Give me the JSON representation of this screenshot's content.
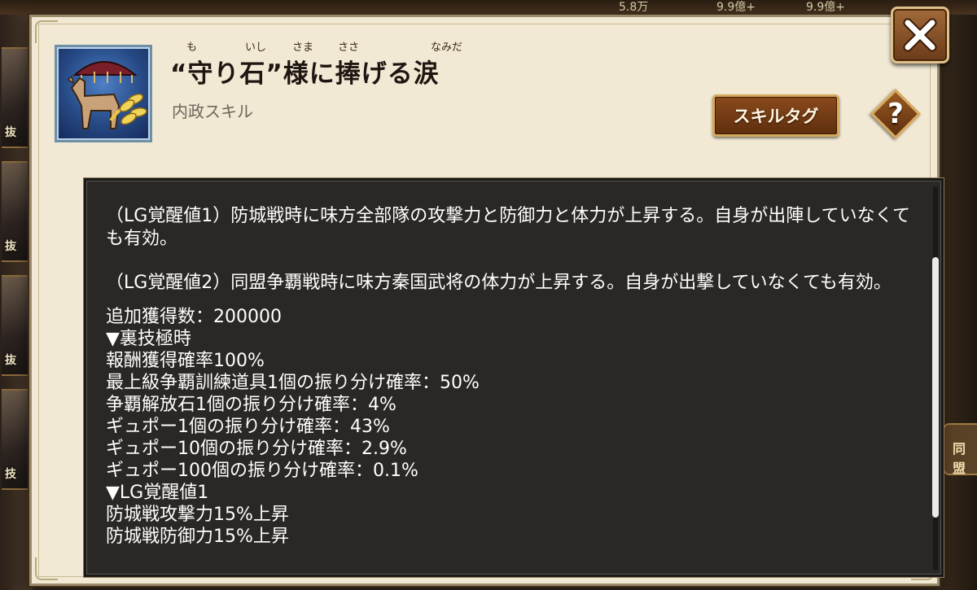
{
  "background": {
    "topbar_values": [
      "5.8万",
      "9.9億+",
      "9.9億+"
    ],
    "left_labels": [
      "抜",
      "抜",
      "抜",
      "技"
    ],
    "right_label": "同盟"
  },
  "skill": {
    "title": "“守り石”様に捧げる涙",
    "ruby": [
      "も",
      "いし",
      "さま",
      "ささ",
      "なみだ"
    ],
    "category": "内政スキル",
    "icon": "horse-and-wheat-icon"
  },
  "buttons": {
    "skill_tag": "スキルタグ",
    "help": "?",
    "close": "close-icon"
  },
  "description": {
    "para1": "（LG覚醒値1）防城戦時に味方全部隊の攻撃力と防御力と体力が上昇する。自身が出陣していなくても有効。",
    "para2": "（LG覚醒値2）同盟争覇戦時に味方秦国武将の体力が上昇する。自身が出撃していなくても有効。",
    "lines": [
      "追加獲得数：200000",
      "▼裏技極時",
      "報酬獲得確率100%",
      "最上級争覇訓練道具1個の振り分け確率：50%",
      "争覇解放石1個の振り分け確率：4%",
      "ギュポー1個の振り分け確率：43%",
      "ギュポー10個の振り分け確率：2.9%",
      "ギュポー100個の振り分け確率：0.1%",
      "▼LG覚醒値1",
      "防城戦攻撃力15%上昇",
      "防城戦防御力15%上昇"
    ]
  },
  "colors": {
    "dialog_bg": "#f1e9d4",
    "panel_bg": "#2a2725",
    "button_brown": "#7a3e16",
    "button_border": "#d6a95c"
  }
}
